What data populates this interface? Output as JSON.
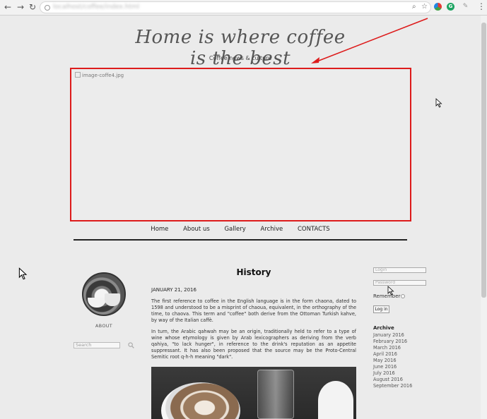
{
  "browser": {
    "url": "localhost/coffee/index.html",
    "extension_letter_g": "G"
  },
  "site": {
    "title": "Home is where coffee is the best",
    "subtitle": "Coffee news & culture",
    "hero_alt": "image-coffe4.jpg"
  },
  "nav": {
    "items": [
      "Home",
      "About us",
      "Gallery",
      "Archive",
      "CONTACTS"
    ]
  },
  "sidebar_left": {
    "about_label": "ABOUT",
    "search_placeholder": "Search"
  },
  "article": {
    "title": "History",
    "date": "JANUARY 21, 2016",
    "paragraph1": "The first reference to coffee in the English language is in the form chaona, dated to 1598 and understood to be a misprint of chaoua, equivalent, in the orthography of the time, to chaova. This term and \"coffee\" both derive from the Ottoman Turkish kahve, by way of the Italian caffè.",
    "paragraph2": "In turn, the Arabic qahwah may be an origin, traditionally held to refer to a type of wine whose etymology is given by Arab lexicographers as deriving from the verb qahiya, \"to lack hunger\", in reference to the drink's reputation as an appetite suppressant. It has also been proposed that the source may be the Proto-Central Semitic root q-h-h meaning \"dark\"."
  },
  "sidebar_right": {
    "login_placeholder": "Login",
    "password_placeholder": "Password",
    "remember_label": "Remember",
    "login_button": "Log in",
    "archive_heading": "Archive",
    "archive_items": [
      "January 2016",
      "February 2016",
      "March 2016",
      "April 2016",
      "May 2016",
      "June 2016",
      "July 2016",
      "August 2016",
      "September 2016"
    ]
  },
  "colors": {
    "highlight": "#dd1b1b",
    "page_bg": "#ebebeb"
  }
}
